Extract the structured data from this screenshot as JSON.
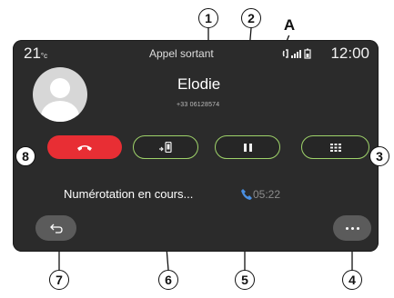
{
  "status_bar": {
    "temperature": "21",
    "temperature_unit": "°c",
    "title": "Appel sortant",
    "clock": "12:00"
  },
  "caller": {
    "name": "Elodie",
    "number": "+33 06128574"
  },
  "call_status": {
    "dialing_text": "Numérotation en cours...",
    "duration": "05:22"
  },
  "buttons": [
    {
      "id": "hangup",
      "icon": "hang-up-phone-icon",
      "color": "#e82e34"
    },
    {
      "id": "transfer",
      "icon": "transfer-to-phone-icon",
      "color": "#9fd36a"
    },
    {
      "id": "pause",
      "icon": "pause-icon",
      "color": "#9fd36a"
    },
    {
      "id": "keypad",
      "icon": "keypad-grid-icon",
      "color": "#9fd36a"
    },
    {
      "id": "back",
      "icon": "back-arrow-icon"
    },
    {
      "id": "more",
      "icon": "more-dots-icon"
    }
  ],
  "callouts": {
    "c1": "1",
    "c2": "2",
    "c3": "3",
    "c4": "4",
    "c5": "5",
    "c6": "6",
    "c7": "7",
    "c8": "8",
    "cA": "A"
  },
  "colors": {
    "screen_bg": "#2b2b2b",
    "accent_green": "#9fd36a",
    "hangup_red": "#e82e34",
    "pill_grey": "#5b5b5b",
    "phone_blue": "#4a90e2"
  }
}
